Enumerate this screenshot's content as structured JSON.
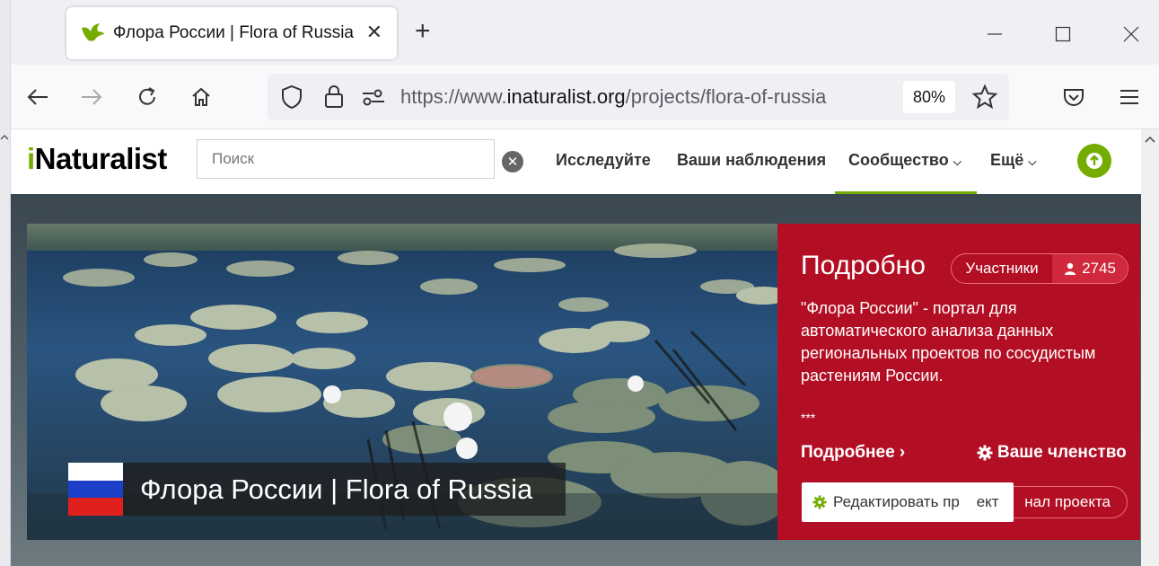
{
  "browser": {
    "tab_title": "Флора России | Flora of Russia",
    "url_prefix": "https://www.",
    "url_domain": "inaturalist.org",
    "url_path": "/projects/flora-of-russia",
    "zoom": "80%"
  },
  "site": {
    "logo_i": "i",
    "logo_rest": "Naturalist",
    "search_placeholder": "Поиск",
    "nav": {
      "explore": "Исследуйте",
      "your_observations": "Ваши наблюдения",
      "community": "Сообщество",
      "more": "Ещё"
    },
    "accent_color": "#74ac00"
  },
  "project": {
    "title": "Флора России | Flora of Russia",
    "panel_heading": "Подробно",
    "members_label": "Участники",
    "members_count": "2745",
    "description": "\"Флора России\" - портал для автоматического анализа данных региональных проектов по сосудистым растениям России.",
    "separator": "***",
    "more_link": "Подробнее",
    "membership": "Ваше членство",
    "journal_button": "нал проекта",
    "edit_button": "Редактировать пр    ект",
    "panel_color": "#b30f24"
  }
}
